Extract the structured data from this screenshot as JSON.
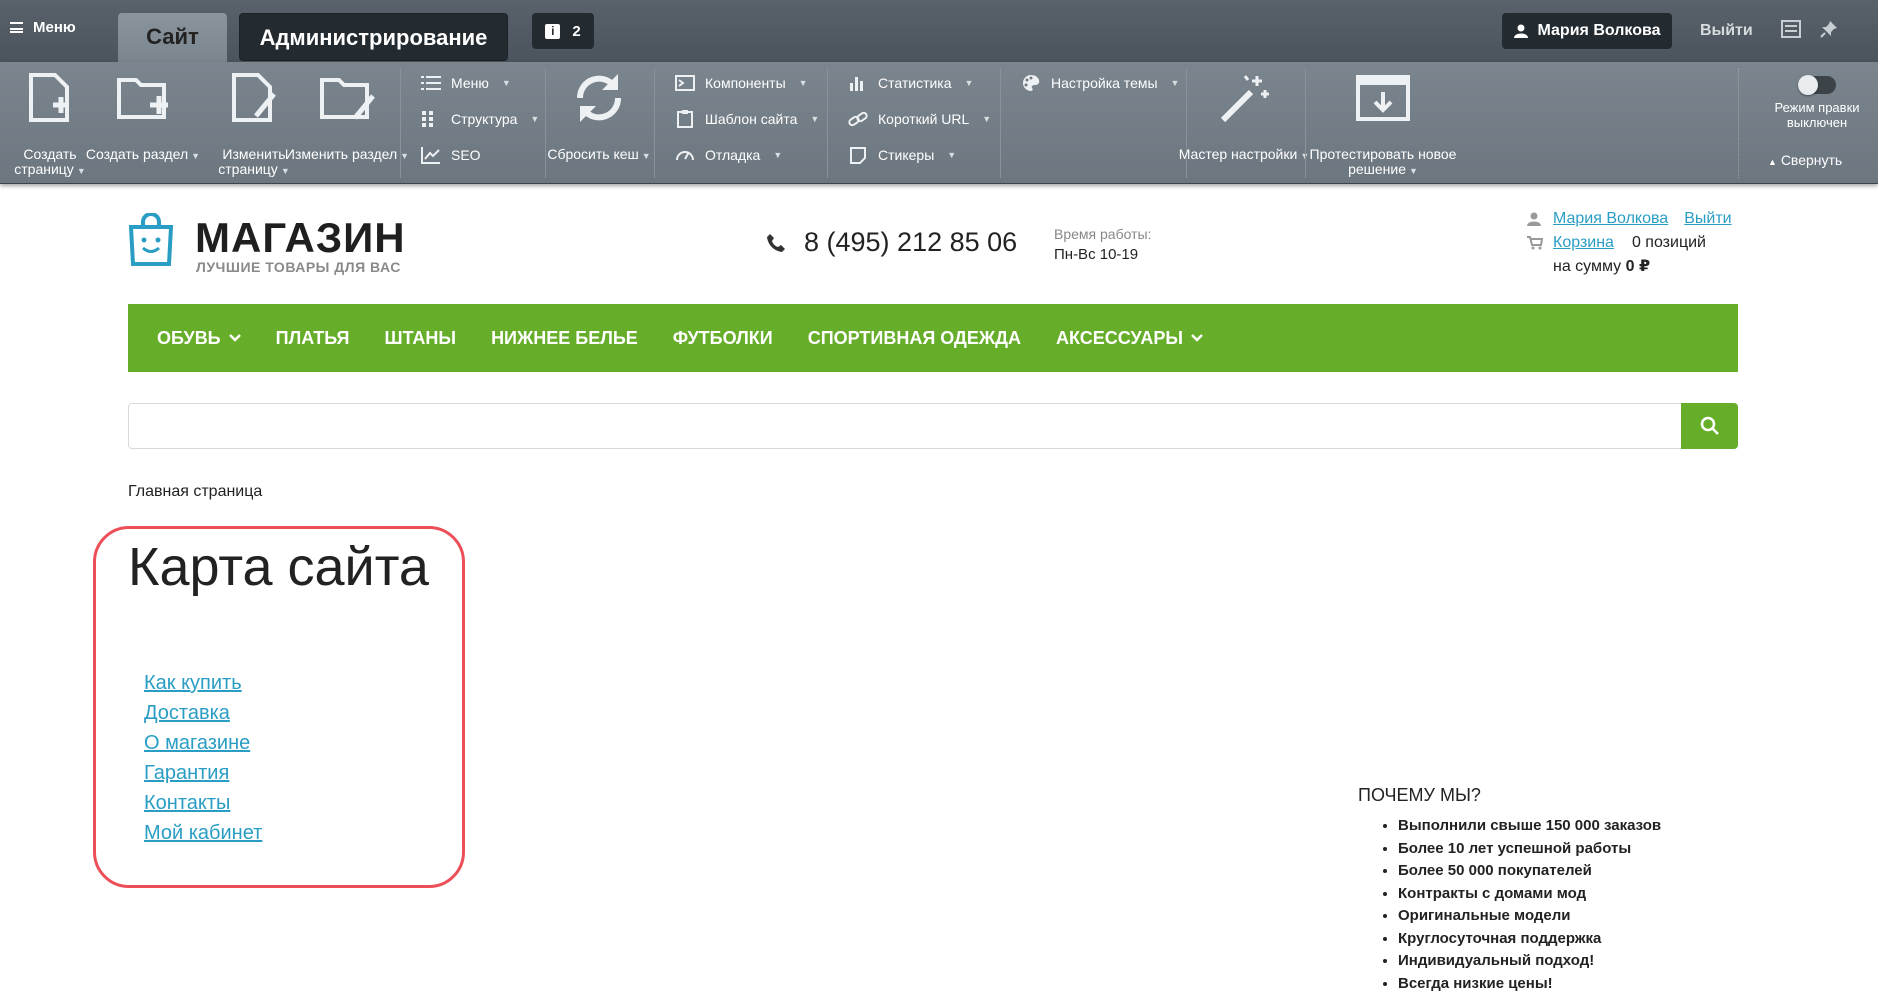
{
  "admin": {
    "menu_label": "Меню",
    "tab_site": "Сайт",
    "tab_admin": "Администрирование",
    "notifications_count": "2",
    "user_name": "Мария Волкова",
    "logout": "Выйти",
    "tools": {
      "create_page": "Создать страницу",
      "create_section": "Создать раздел",
      "edit_page": "Изменить страницу",
      "edit_section": "Изменить раздел",
      "menu": "Меню",
      "structure": "Структура",
      "seo": "SEO",
      "reset_cache": "Сбросить кеш",
      "components": "Компоненты",
      "site_template": "Шаблон сайта",
      "debug": "Отладка",
      "statistics": "Статистика",
      "short_url": "Короткий URL",
      "stickers": "Стикеры",
      "theme_settings": "Настройка темы",
      "setup_wizard": "Мастер настройки",
      "test_solution": "Протестировать новое решение"
    },
    "edit_mode_label": "Режим правки выключен",
    "collapse": "Свернуть"
  },
  "header": {
    "logo_title": "МАГАЗИН",
    "logo_subtitle": "ЛУЧШИЕ ТОВАРЫ ДЛЯ ВАС",
    "phone": "8 (495) 212 85 06",
    "work_label": "Время работы:",
    "work_hours": "Пн-Вс 10-19",
    "user_link": "Мария Волкова",
    "logout_link": "Выйти",
    "cart_link": "Корзина",
    "cart_count": "0 позиций",
    "cart_sum_label": "на сумму",
    "cart_sum": "0 ₽"
  },
  "nav": {
    "items": [
      "ОБУВЬ",
      "ПЛАТЬЯ",
      "ШТАНЫ",
      "НИЖНЕЕ БЕЛЬЕ",
      "ФУТБОЛКИ",
      "СПОРТИВНАЯ ОДЕЖДА",
      "АКСЕССУАРЫ"
    ]
  },
  "colors": {
    "accent_green": "#66ad2a",
    "link_blue": "#2a9dc4",
    "highlight_red": "#ec4f58"
  },
  "breadcrumb": "Главная страница",
  "page_title": "Карта сайта",
  "sitemap": [
    "Как купить",
    "Доставка",
    "О магазине",
    "Гарантия",
    "Контакты",
    "Мой кабинет"
  ],
  "why": {
    "title": "ПОЧЕМУ МЫ?",
    "items": [
      "Выполнили свыше 150 000 заказов",
      "Более 10 лет успешной работы",
      "Более 50 000 покупателей",
      "Контракты с домами мод",
      "Оригинальные модели",
      "Круглосуточная поддержка",
      "Индивидуальный подход!",
      "Всегда низкие цены!"
    ]
  }
}
